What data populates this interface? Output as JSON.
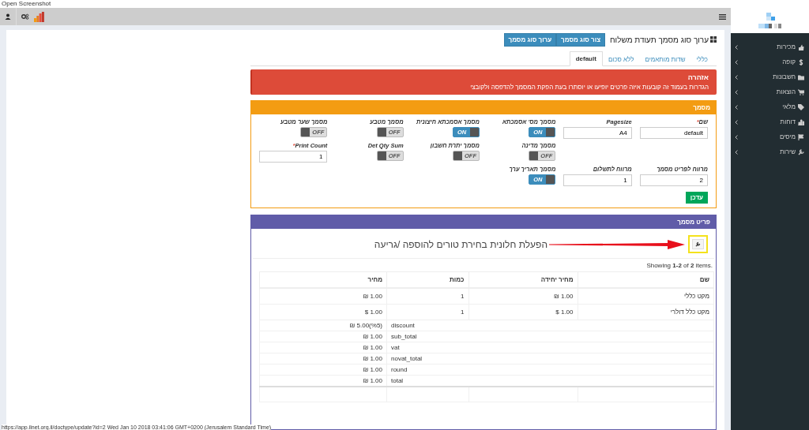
{
  "screenshot_title": "Open Screenshot",
  "sidebar": {
    "items": [
      {
        "label": "מכירות"
      },
      {
        "label": "קופה"
      },
      {
        "label": "חשבונות"
      },
      {
        "label": "הוצאות"
      },
      {
        "label": "מלאי"
      },
      {
        "label": "דוחות"
      },
      {
        "label": "מיסים"
      },
      {
        "label": "שירות"
      }
    ]
  },
  "page": {
    "title": "ערוך סוג מסמך תעודת משלוח",
    "buttons": [
      "צור סוג מסמך",
      "ערוך סוג מסמך"
    ]
  },
  "tabs": [
    {
      "label": "כללי",
      "selected": false
    },
    {
      "label": "שדות מותאמים",
      "selected": false
    },
    {
      "label": "ללא סכום",
      "selected": false
    },
    {
      "label": "default",
      "selected": true
    }
  ],
  "alert": {
    "title": "אזהרה",
    "text": "הגדרות בעמוד זה קובעות איזה פרטים יופיעו או יוסתרו בעת הפקת המסמך להדפסה ולקובצי"
  },
  "settings": {
    "title": "מסמך",
    "submit": "עדכן",
    "fields": [
      {
        "kind": "input",
        "label": "שם",
        "marker": "*",
        "value": "default"
      },
      {
        "kind": "input",
        "label": "Pagesize",
        "value": "A4"
      },
      {
        "kind": "toggle",
        "label": "מסמך מס' אסמכתא",
        "on": true,
        "state_label": "ON"
      },
      {
        "kind": "toggle",
        "label": "מסמך אסמכתא חיצונית",
        "on": true,
        "state_label": "ON"
      },
      {
        "kind": "toggle",
        "label": "מסמך מטבע",
        "on": false,
        "state_label": "OFF"
      },
      {
        "kind": "toggle",
        "label": "מסמך שער מטבע",
        "on": false,
        "state_label": "OFF"
      },
      {
        "kind": "empty"
      },
      {
        "kind": "empty"
      },
      {
        "kind": "toggle",
        "label": "מסמך מדינה",
        "on": false,
        "state_label": "OFF"
      },
      {
        "kind": "toggle",
        "label": "מסמך יתרת חשבון",
        "on": false,
        "state_label": "OFF"
      },
      {
        "kind": "toggle",
        "label": "Det Qty Sum",
        "on": false,
        "state_label": "OFF"
      },
      {
        "kind": "input",
        "label": "Print Count",
        "marker": "*",
        "value": "1"
      },
      {
        "kind": "input",
        "label": "מרווח לפריט מסמך",
        "value": "2"
      },
      {
        "kind": "input",
        "label": "מרווח לתשלום",
        "value": "1"
      },
      {
        "kind": "toggle",
        "label": "מסמך תאריך ערך",
        "on": true,
        "state_label": "ON"
      }
    ]
  },
  "items_panel": {
    "title": "פריט מסמך",
    "annotation": "הפעלת חלונית בחירת טורים להוספה /גריעה",
    "summary": "Showing **1-2** of **2** items.",
    "columns": [
      "שם",
      "מחיר יחידה",
      "כמות",
      "מחיר"
    ],
    "rows": [
      [
        "מקט כללי",
        "₪ 1.00",
        "1",
        "₪ 1.00"
      ],
      [
        "מקט כלל דולרי",
        "$ 1.00",
        "1",
        "$ 1.00"
      ]
    ],
    "totals": [
      {
        "label": "discount",
        "value": "₪ 5.00(%5)"
      },
      {
        "label": "sub_total",
        "value": "₪ 1.00"
      },
      {
        "label": "vat",
        "value": "₪ 1.00"
      },
      {
        "label": "novat_total",
        "value": "₪ 1.00"
      },
      {
        "label": "round",
        "value": "₪ 1.00"
      },
      {
        "label": "total",
        "value": "₪ 1.00"
      }
    ]
  },
  "status_bar": "https://app.ilnet.org.il/doctype/update?id=2 Wed Jan 10 2018 03:41:06 GMT+0200 (Jerusalem Standard Time)"
}
